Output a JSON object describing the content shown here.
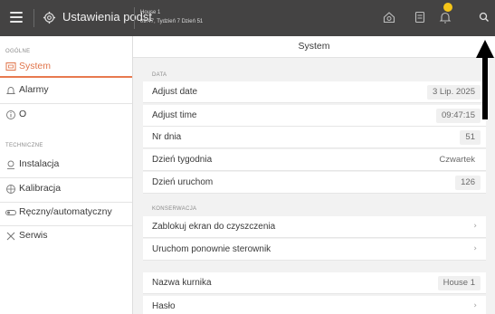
{
  "topbar": {
    "app_title": "Ustawienia podst",
    "house_name": "House 1",
    "house_info": "09:47, Tydzień 7 Dzień 51"
  },
  "sidebar": {
    "section_general": "OGÓLNE",
    "section_technical": "TECHNICZNE",
    "items": [
      {
        "label": "System",
        "icon": "monitor-icon",
        "active": true
      },
      {
        "label": "Alarmy",
        "icon": "bell-icon"
      },
      {
        "label": "O",
        "icon": "info-icon"
      },
      {
        "label": "Instalacja",
        "icon": "installation-icon"
      },
      {
        "label": "Kalibracja",
        "icon": "calibration-icon"
      },
      {
        "label": "Ręczny/automatyczny",
        "icon": "toggle-icon"
      },
      {
        "label": "Serwis",
        "icon": "tools-icon"
      }
    ]
  },
  "main": {
    "title": "System",
    "group_data": "DATA",
    "group_konserwacja": "KONSERWACJA",
    "rows": [
      {
        "label": "Adjust date",
        "value": "3 Lip. 2025"
      },
      {
        "label": "Adjust time",
        "value": "09:47:15"
      },
      {
        "label": "Nr dnia",
        "value": "51"
      },
      {
        "label": "Dzień tygodnia",
        "value": "Czwartek"
      },
      {
        "label": "Dzień uruchom",
        "value": "126"
      },
      {
        "label": "Zablokuj ekran do czyszczenia",
        "value": "›"
      },
      {
        "label": "Uruchom ponownie sterownik",
        "value": "›"
      },
      {
        "label": "Nazwa kurnika",
        "value": "House 1"
      },
      {
        "label": "Hasło",
        "value": "›"
      }
    ]
  },
  "colors": {
    "topbar_bg": "#444343",
    "accent": "#e8794f",
    "notification_dot": "#f5c518",
    "content_bg": "#f2f2f2"
  }
}
